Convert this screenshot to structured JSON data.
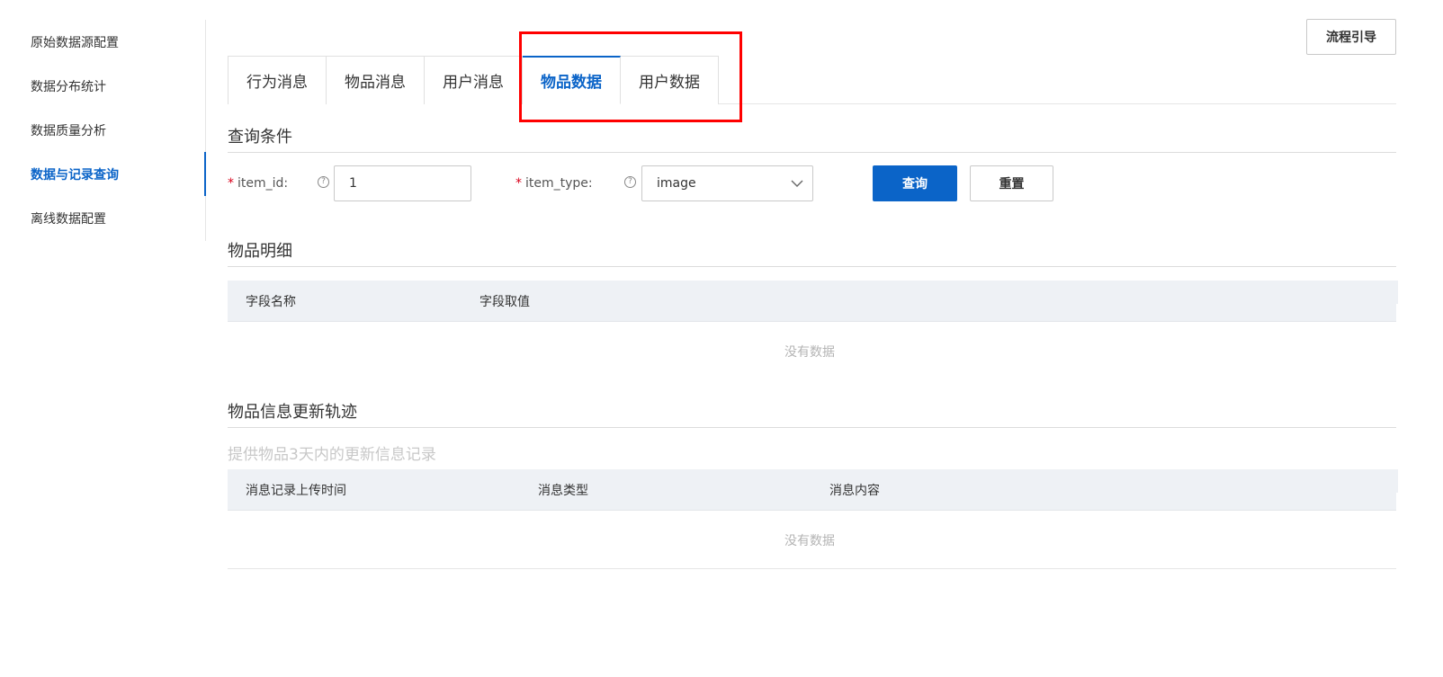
{
  "sidebar": {
    "items": [
      {
        "label": "原始数据源配置"
      },
      {
        "label": "数据分布统计"
      },
      {
        "label": "数据质量分析"
      },
      {
        "label": "数据与记录查询"
      },
      {
        "label": "离线数据配置"
      }
    ],
    "active_index": 3
  },
  "header": {
    "guide_button_label": "流程引导"
  },
  "tabs": {
    "items": [
      {
        "label": "行为消息"
      },
      {
        "label": "物品消息"
      },
      {
        "label": "用户消息"
      },
      {
        "label": "物品数据"
      },
      {
        "label": "用户数据"
      }
    ],
    "active_index": 3
  },
  "query": {
    "title": "查询条件",
    "item_id": {
      "label": "item_id:",
      "required_mark": "*",
      "value": "1",
      "help_icon": "question-circle-icon"
    },
    "item_type": {
      "label": "item_type:",
      "required_mark": "*",
      "value": "image",
      "help_icon": "question-circle-icon"
    },
    "search_button_label": "查询",
    "reset_button_label": "重置"
  },
  "item_detail": {
    "title": "物品明细",
    "columns": [
      "字段名称",
      "字段取值"
    ],
    "rows": [],
    "empty_text": "没有数据"
  },
  "update_trace": {
    "title": "物品信息更新轨迹",
    "description": "提供物品3天内的更新信息记录",
    "columns": [
      "消息记录上传时间",
      "消息类型",
      "消息内容"
    ],
    "rows": [],
    "empty_text": "没有数据"
  },
  "colors": {
    "primary": "#0b64c8",
    "highlight": "#ff0000",
    "required": "#d9001b",
    "table_header_bg": "#eef1f5"
  }
}
